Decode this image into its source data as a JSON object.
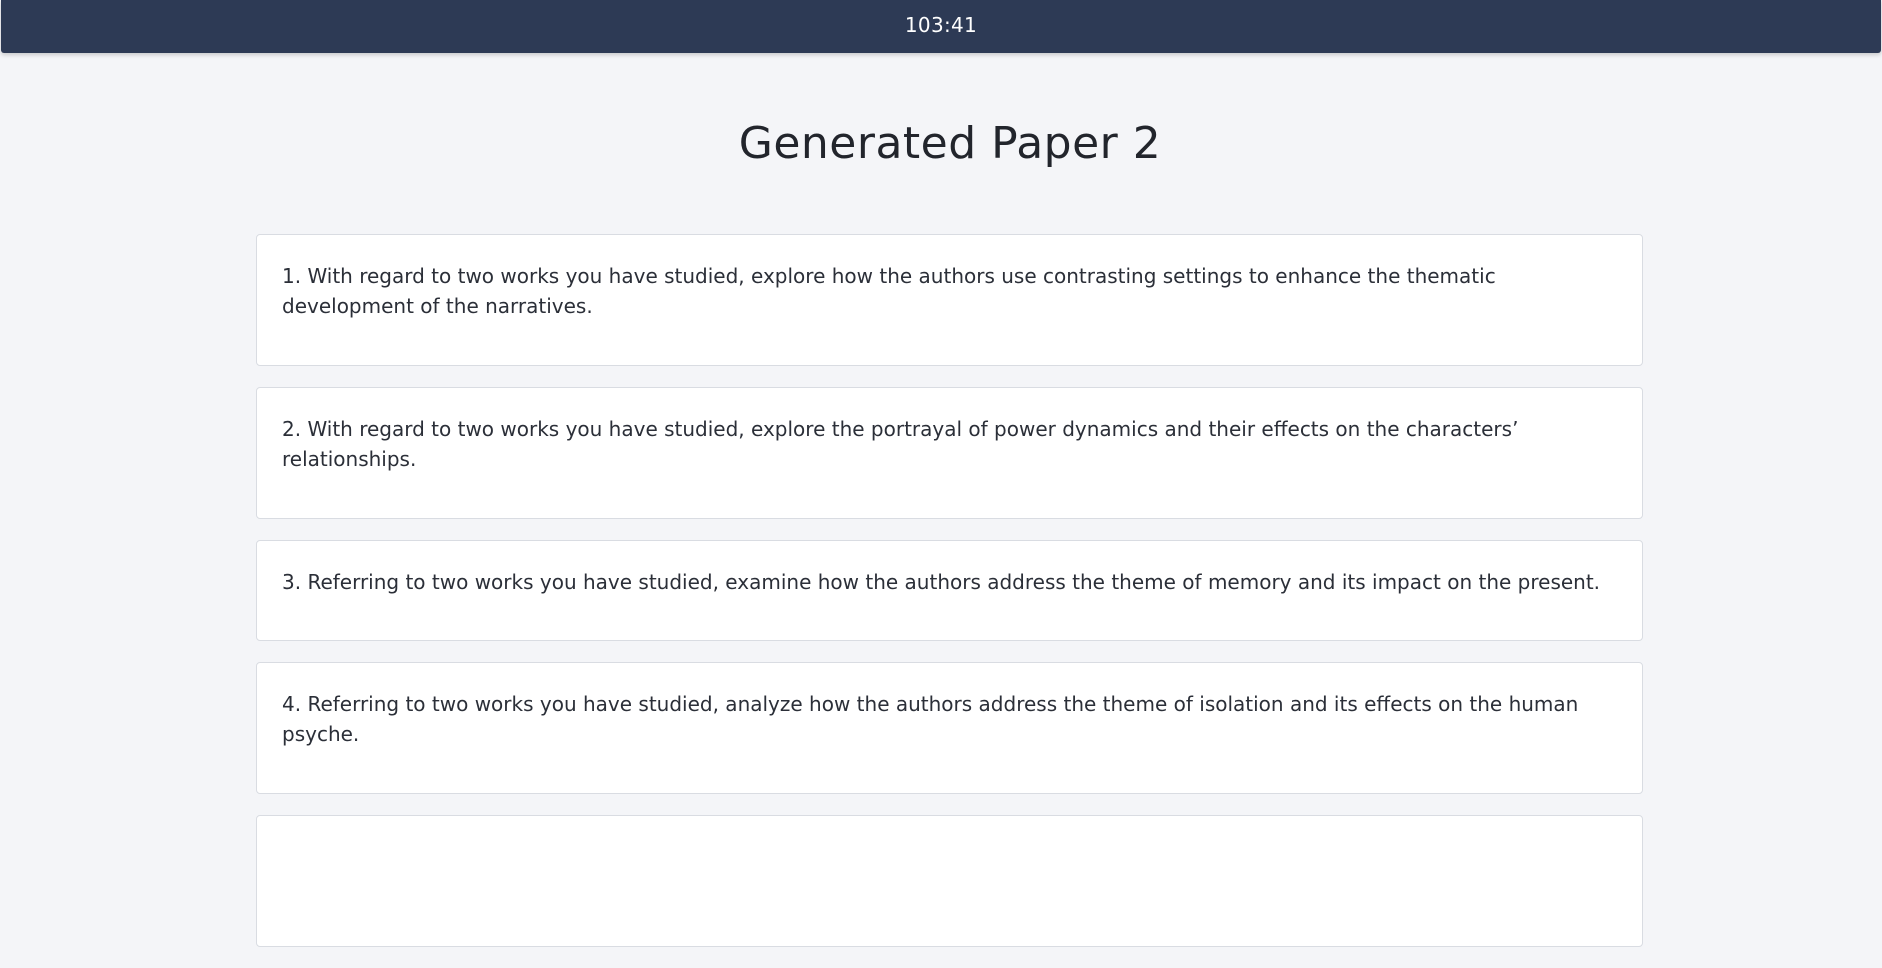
{
  "header": {
    "timer": "103:41"
  },
  "page": {
    "title": "Generated Paper 2"
  },
  "questions": [
    {
      "text": "1. With regard to two works you have studied, explore how the authors use contrasting settings to enhance the thematic development of the narratives."
    },
    {
      "text": "2. With regard to two works you have studied, explore the portrayal of power dynamics and their effects on the characters’ relationships."
    },
    {
      "text": "3. Referring to two works you have studied, examine how the authors address the theme of memory and its impact on the present."
    },
    {
      "text": "4. Referring to two works you have studied, analyze how the authors address the theme of isolation and its effects on the human psyche."
    },
    {
      "text": ""
    }
  ],
  "colors": {
    "topbar": "#2d3a55",
    "background": "#f4f5f8",
    "card": "#ffffff",
    "card_border": "#d9dce2"
  }
}
